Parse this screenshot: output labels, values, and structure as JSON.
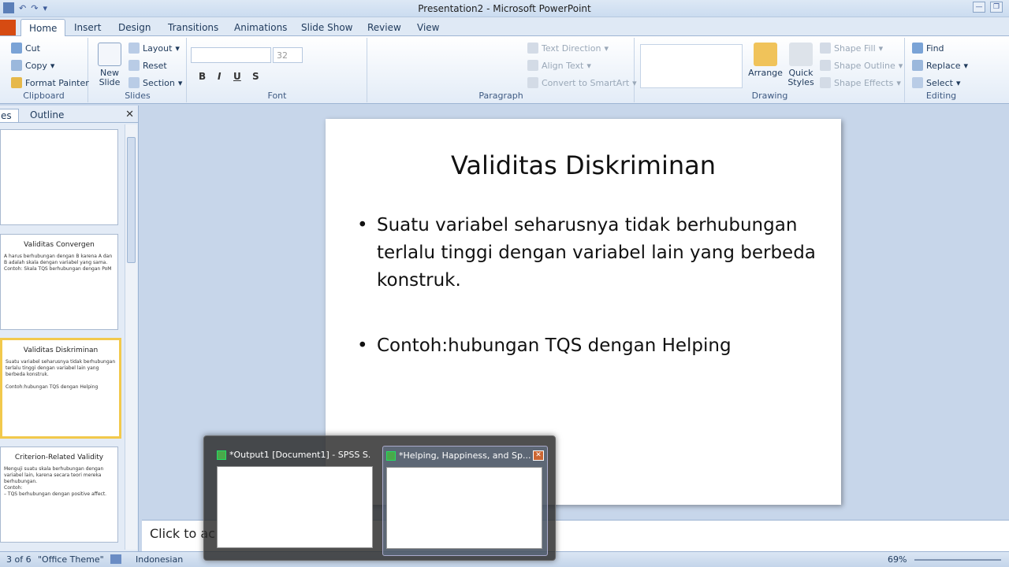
{
  "window": {
    "title": "Presentation2 - Microsoft PowerPoint"
  },
  "tabs": [
    "Home",
    "Insert",
    "Design",
    "Transitions",
    "Animations",
    "Slide Show",
    "Review",
    "View"
  ],
  "ribbon": {
    "clipboard": {
      "cut": "Cut",
      "copy": "Copy",
      "format_painter": "Format Painter",
      "label": "Clipboard"
    },
    "slides": {
      "new_slide": "New Slide",
      "layout": "Layout",
      "reset": "Reset",
      "section": "Section",
      "label": "Slides"
    },
    "font": {
      "size": "32",
      "label": "Font"
    },
    "paragraph": {
      "text_direction": "Text Direction",
      "align_text": "Align Text",
      "convert": "Convert to SmartArt",
      "label": "Paragraph"
    },
    "drawing": {
      "arrange": "Arrange",
      "quick_styles": "Quick Styles",
      "shape_fill": "Shape Fill",
      "shape_outline": "Shape Outline",
      "shape_effects": "Shape Effects",
      "label": "Drawing"
    },
    "editing": {
      "find": "Find",
      "replace": "Replace",
      "select": "Select",
      "label": "Editing"
    }
  },
  "panel": {
    "tabs": [
      "es",
      "Outline"
    ],
    "thumbs": [
      {
        "title": "",
        "body": []
      },
      {
        "title": "Validitas Convergen",
        "body": [
          "A harus berhubungan dengan B karena A dan B adalah skala dengan variabel yang sama.",
          "Contoh: Skala TQS berhubungan dengan PoM"
        ]
      },
      {
        "title": "Validitas Diskriminan",
        "body": [
          "Suatu variabel seharusnya tidak berhubungan terlalu tinggi dengan variabel lain yang berbeda konstruk.",
          "Contoh:hubungan TQS dengan Helping"
        ]
      },
      {
        "title": "Criterion-Related Validity",
        "body": [
          "Menguji suatu skala berhubungan dengan variabel lain, karena secara teori mereka berhubungan.",
          "Contoh:",
          "– TQS berhubungan dengan positive affect."
        ]
      }
    ]
  },
  "slide": {
    "title": "Validitas Diskriminan",
    "bullets": [
      "Suatu variabel seharusnya tidak berhubungan terlalu tinggi dengan variabel lain yang berbeda konstruk.",
      "Contoh:hubungan  TQS dengan Helping"
    ]
  },
  "notes": {
    "placeholder": "Click to ac"
  },
  "status": {
    "slide": "3 of 6",
    "theme": "\"Office Theme\"",
    "language": "Indonesian",
    "zoom": "69%"
  },
  "taskbar_popup": {
    "items": [
      {
        "label": "*Output1 [Document1] - SPSS S..."
      },
      {
        "label": "*Helping, Happiness, and Sp..."
      }
    ]
  }
}
